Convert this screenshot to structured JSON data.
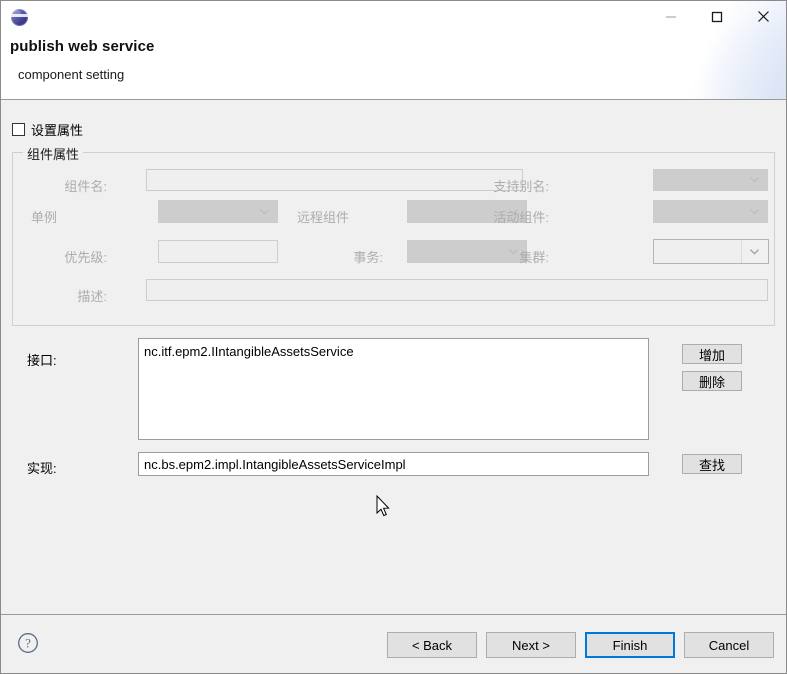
{
  "window": {
    "icon": "eclipse-globe-icon",
    "controls": [
      {
        "name": "minimize",
        "glyph": "minimize-icon"
      },
      {
        "name": "maximize",
        "glyph": "maximize-icon"
      },
      {
        "name": "close",
        "glyph": "close-icon"
      }
    ]
  },
  "header": {
    "title": "publish web service",
    "subtitle": "component setting"
  },
  "top_checkbox": {
    "label": "设置属性",
    "checked": false
  },
  "group": {
    "title": "组件属性",
    "fields": {
      "component_name": {
        "label": "组件名:",
        "value": "",
        "type": "textbox",
        "enabled": false
      },
      "alias_support": {
        "label": "支持别名:",
        "value": "",
        "type": "combo",
        "enabled": false
      },
      "singleton": {
        "label": "单例",
        "value": "",
        "type": "combo",
        "enabled": false
      },
      "remote_component": {
        "label": "远程组件",
        "value": "",
        "type": "combo",
        "enabled": false
      },
      "active_component": {
        "label": "活动组件:",
        "value": "",
        "type": "combo",
        "enabled": false
      },
      "priority": {
        "label": "优先级:",
        "value": "",
        "type": "textbox",
        "enabled": false
      },
      "transaction": {
        "label": "事务:",
        "value": "",
        "type": "combo",
        "enabled": false
      },
      "cluster": {
        "label": "集群:",
        "value": "",
        "type": "combo",
        "enabled": true
      },
      "description": {
        "label": "描述:",
        "value": "",
        "type": "textbox",
        "enabled": false
      }
    }
  },
  "interface_section": {
    "label": "接口:",
    "value": "nc.itf.epm2.IIntangibleAssetsService",
    "add_button": "增加",
    "delete_button": "删除"
  },
  "implementation_section": {
    "label": "实现:",
    "value": "nc.bs.epm2.impl.IntangibleAssetsServiceImpl",
    "find_button": "查找"
  },
  "footer": {
    "help_icon": "help-question-icon",
    "buttons": {
      "back": "< Back",
      "next": "Next >",
      "finish": "Finish",
      "cancel": "Cancel"
    },
    "default_button": "Finish"
  },
  "colors": {
    "accent": "#0078d7",
    "dialog_bg": "#f0f0f0",
    "header_bg": "#ffffff",
    "disabled_text": "#adadad",
    "disabled_combo": "#cdcdcd",
    "field_bg": "#efefef",
    "button_bg": "#e1e1e1",
    "border": "#9a9a9a"
  }
}
